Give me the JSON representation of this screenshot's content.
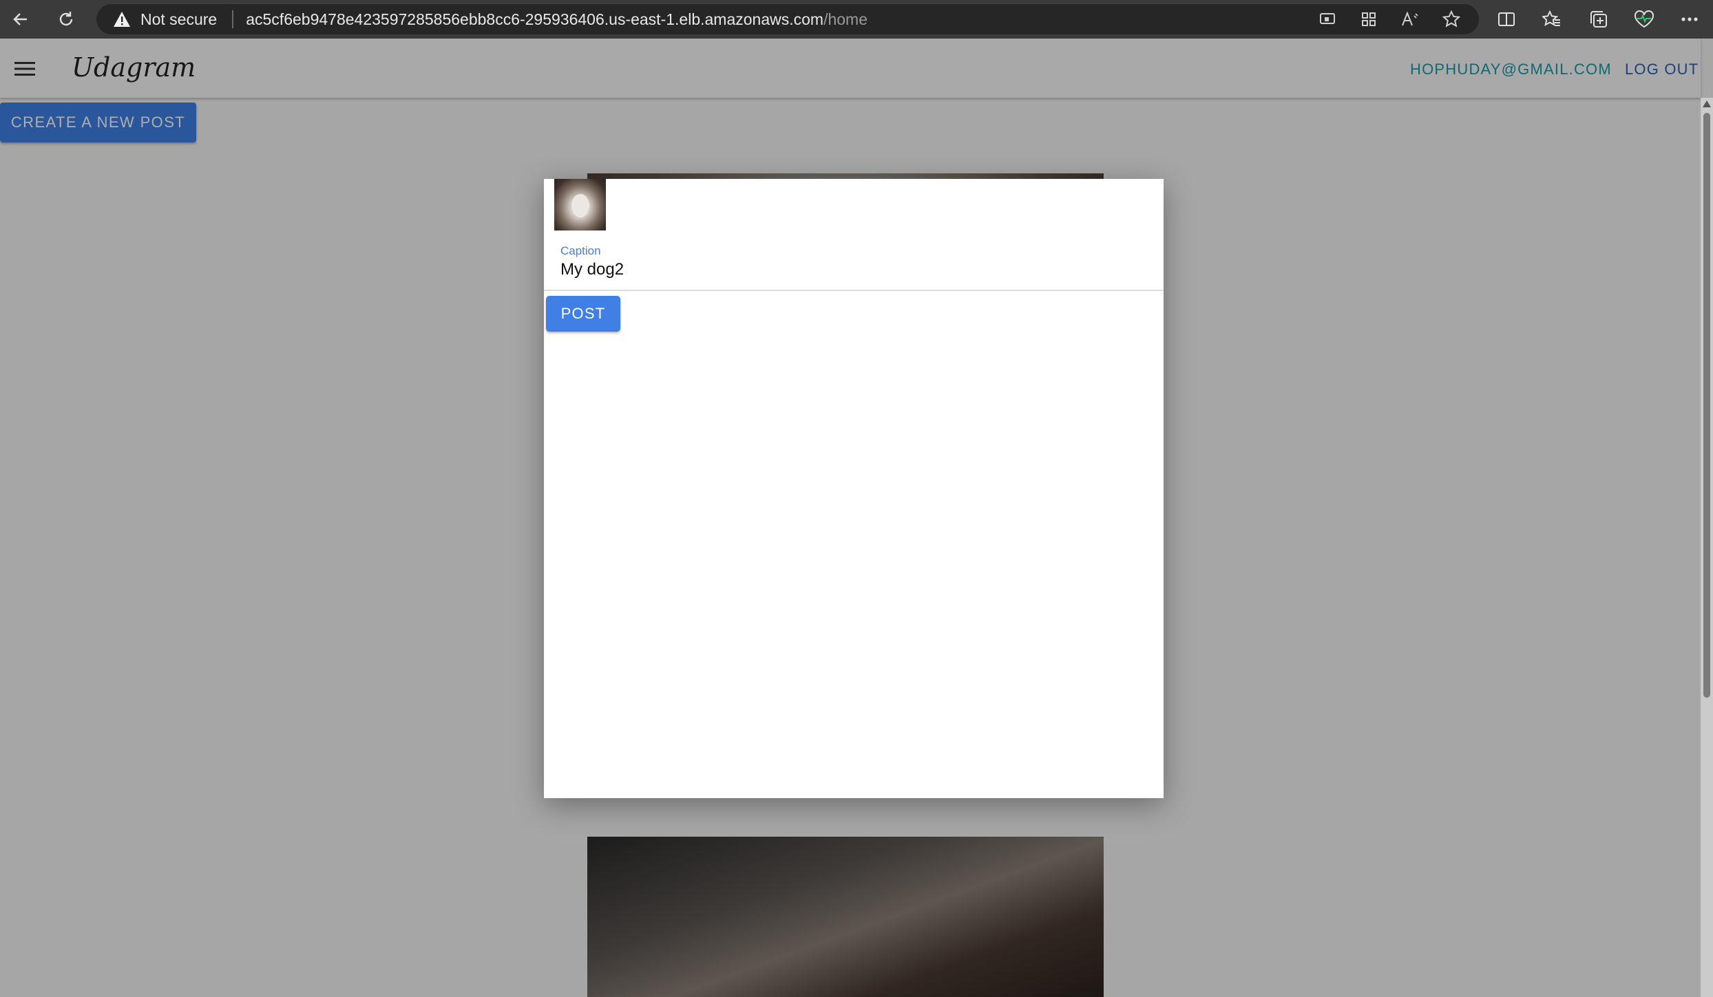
{
  "browser": {
    "security_label": "Not secure",
    "url_host": "ac5cf6eb9478e423597285856ebb8cc6-295936406.us-east-1.elb.amazonaws.com",
    "url_path": "/home"
  },
  "app": {
    "brand": "Udagram",
    "user_email": "HOPHUDAY@GMAIL.COM",
    "logout_label": "LOG OUT",
    "create_post_label": "CREATE A NEW POST"
  },
  "modal": {
    "caption_label": "Caption",
    "caption_value": "My dog2",
    "post_label": "POST"
  },
  "colors": {
    "primary": "#3f7fe6",
    "email_link": "#1a9aa8",
    "logout_link": "#2a5fb0"
  }
}
